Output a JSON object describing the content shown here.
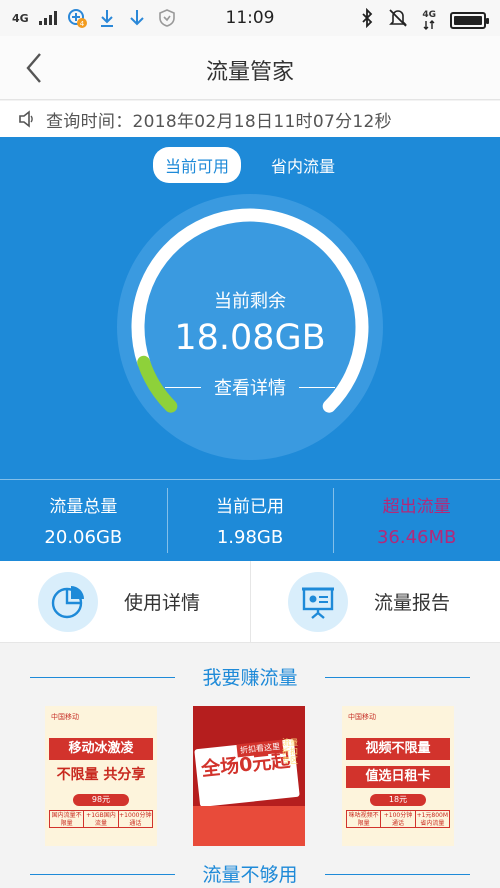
{
  "status_bar": {
    "network": "4G",
    "time": "11:09",
    "notification_badge": "4",
    "right_network": "4G"
  },
  "nav": {
    "title": "流量管家"
  },
  "query": {
    "text": "查询时间：2018年02月18日11时07分12秒"
  },
  "tabs": [
    {
      "label": "当前可用",
      "active": true
    },
    {
      "label": "省内流量",
      "active": false
    }
  ],
  "gauge": {
    "label": "当前剩余",
    "value": "18.08GB",
    "link": "查看详情",
    "used_fraction": 0.0987,
    "colors": {
      "track": "#ffffff",
      "used": "#8ed13a",
      "ring_bg": "#3a9ae0"
    }
  },
  "stats": [
    {
      "label": "流量总量",
      "value": "20.06GB"
    },
    {
      "label": "当前已用",
      "value": "1.98GB"
    },
    {
      "label": "超出流量",
      "value": "36.46MB"
    }
  ],
  "actions": [
    {
      "label": "使用详情",
      "icon": "pie-chart-icon"
    },
    {
      "label": "流量报告",
      "icon": "report-board-icon"
    }
  ],
  "sections": {
    "earn": "我要赚流量",
    "not_enough": "流量不够用"
  },
  "promos": [
    {
      "brand": "中国移动",
      "banner": "移动冰激凌",
      "sub": "不限量 共分享",
      "price": "98元",
      "fine": [
        "国内流量不限量",
        "+1GB国内流量",
        "+1000分钟通话"
      ]
    },
    {
      "big": "全场0元起",
      "small": "折扣看这里",
      "tag": "流量折扣专区"
    },
    {
      "brand": "中国移动",
      "banner": "视频不限量",
      "sub": "值选日租卡",
      "price": "18元",
      "fine": [
        "咪咕视频不限量",
        "+100分钟通话",
        "+1元800M省内流量"
      ]
    }
  ],
  "colors": {
    "primary": "#1e8ad8",
    "over": "#b2297a",
    "promo_red": "#d2332c"
  }
}
